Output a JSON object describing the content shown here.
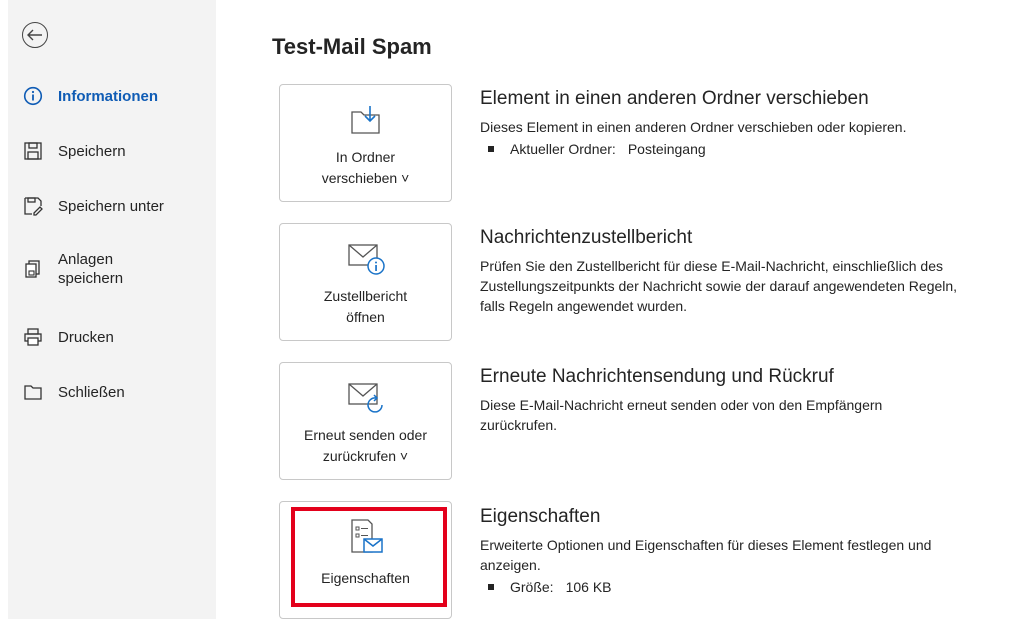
{
  "sidebar": {
    "items": [
      {
        "label": "Informationen",
        "icon": "info-icon"
      },
      {
        "label": "Speichern",
        "icon": "save-icon"
      },
      {
        "label": "Speichern unter",
        "icon": "save-as-icon"
      },
      {
        "label_line1": "Anlagen",
        "label_line2": "speichern",
        "icon": "attachments-icon"
      },
      {
        "label": "Drucken",
        "icon": "printer-icon"
      },
      {
        "label": "Schließen",
        "icon": "close-folder-icon"
      }
    ]
  },
  "main": {
    "title": "Test-Mail Spam",
    "cards": [
      {
        "line1": "In Ordner",
        "line2": "verschieben ˅",
        "icon": "move-folder-icon"
      },
      {
        "line1": "Zustellbericht",
        "line2": "öffnen",
        "icon": "delivery-report-icon"
      },
      {
        "line1": "Erneut senden oder",
        "line2": "zurückrufen ˅",
        "icon": "resend-icon"
      },
      {
        "line1": "Eigenschaften",
        "icon": "properties-icon"
      }
    ],
    "sections": [
      {
        "heading": "Element in einen anderen Ordner verschieben",
        "text": "Dieses Element in einen anderen Ordner verschieben oder kopieren.",
        "bullet_key": "Aktueller Ordner:",
        "bullet_value": "Posteingang"
      },
      {
        "heading": "Nachrichtenzustellbericht",
        "text_line1": "Prüfen Sie den Zustellbericht für diese E-Mail-Nachricht, einschließlich des",
        "text_line2": "Zustellungszeitpunkts der Nachricht sowie der darauf angewendeten Regeln,",
        "text_line3": "falls Regeln angewendet wurden."
      },
      {
        "heading": "Erneute Nachrichtensendung und Rückruf",
        "text_line1": "Diese E-Mail-Nachricht erneut senden oder von den Empfängern",
        "text_line2": "zurückrufen."
      },
      {
        "heading": "Eigenschaften",
        "text_line1": "Erweiterte Optionen und Eigenschaften für dieses Element festlegen und",
        "text_line2": "anzeigen.",
        "bullet_key": "Größe:",
        "bullet_value": "106 KB"
      }
    ]
  },
  "colors": {
    "accent": "#0f5cb5",
    "highlight": "#e3001b",
    "sidebar_bg": "#f3f3f3"
  }
}
